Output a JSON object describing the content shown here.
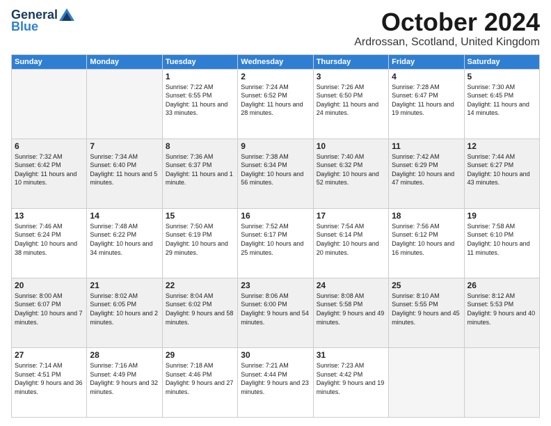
{
  "logo": {
    "general": "General",
    "blue": "Blue"
  },
  "title": "October 2024",
  "location": "Ardrossan, Scotland, United Kingdom",
  "days_of_week": [
    "Sunday",
    "Monday",
    "Tuesday",
    "Wednesday",
    "Thursday",
    "Friday",
    "Saturday"
  ],
  "weeks": [
    [
      {
        "day": "",
        "sunrise": "",
        "sunset": "",
        "daylight": "",
        "empty": true
      },
      {
        "day": "",
        "sunrise": "",
        "sunset": "",
        "daylight": "",
        "empty": true
      },
      {
        "day": "1",
        "sunrise": "Sunrise: 7:22 AM",
        "sunset": "Sunset: 6:55 PM",
        "daylight": "Daylight: 11 hours and 33 minutes."
      },
      {
        "day": "2",
        "sunrise": "Sunrise: 7:24 AM",
        "sunset": "Sunset: 6:52 PM",
        "daylight": "Daylight: 11 hours and 28 minutes."
      },
      {
        "day": "3",
        "sunrise": "Sunrise: 7:26 AM",
        "sunset": "Sunset: 6:50 PM",
        "daylight": "Daylight: 11 hours and 24 minutes."
      },
      {
        "day": "4",
        "sunrise": "Sunrise: 7:28 AM",
        "sunset": "Sunset: 6:47 PM",
        "daylight": "Daylight: 11 hours and 19 minutes."
      },
      {
        "day": "5",
        "sunrise": "Sunrise: 7:30 AM",
        "sunset": "Sunset: 6:45 PM",
        "daylight": "Daylight: 11 hours and 14 minutes."
      }
    ],
    [
      {
        "day": "6",
        "sunrise": "Sunrise: 7:32 AM",
        "sunset": "Sunset: 6:42 PM",
        "daylight": "Daylight: 11 hours and 10 minutes."
      },
      {
        "day": "7",
        "sunrise": "Sunrise: 7:34 AM",
        "sunset": "Sunset: 6:40 PM",
        "daylight": "Daylight: 11 hours and 5 minutes."
      },
      {
        "day": "8",
        "sunrise": "Sunrise: 7:36 AM",
        "sunset": "Sunset: 6:37 PM",
        "daylight": "Daylight: 11 hours and 1 minute."
      },
      {
        "day": "9",
        "sunrise": "Sunrise: 7:38 AM",
        "sunset": "Sunset: 6:34 PM",
        "daylight": "Daylight: 10 hours and 56 minutes."
      },
      {
        "day": "10",
        "sunrise": "Sunrise: 7:40 AM",
        "sunset": "Sunset: 6:32 PM",
        "daylight": "Daylight: 10 hours and 52 minutes."
      },
      {
        "day": "11",
        "sunrise": "Sunrise: 7:42 AM",
        "sunset": "Sunset: 6:29 PM",
        "daylight": "Daylight: 10 hours and 47 minutes."
      },
      {
        "day": "12",
        "sunrise": "Sunrise: 7:44 AM",
        "sunset": "Sunset: 6:27 PM",
        "daylight": "Daylight: 10 hours and 43 minutes."
      }
    ],
    [
      {
        "day": "13",
        "sunrise": "Sunrise: 7:46 AM",
        "sunset": "Sunset: 6:24 PM",
        "daylight": "Daylight: 10 hours and 38 minutes."
      },
      {
        "day": "14",
        "sunrise": "Sunrise: 7:48 AM",
        "sunset": "Sunset: 6:22 PM",
        "daylight": "Daylight: 10 hours and 34 minutes."
      },
      {
        "day": "15",
        "sunrise": "Sunrise: 7:50 AM",
        "sunset": "Sunset: 6:19 PM",
        "daylight": "Daylight: 10 hours and 29 minutes."
      },
      {
        "day": "16",
        "sunrise": "Sunrise: 7:52 AM",
        "sunset": "Sunset: 6:17 PM",
        "daylight": "Daylight: 10 hours and 25 minutes."
      },
      {
        "day": "17",
        "sunrise": "Sunrise: 7:54 AM",
        "sunset": "Sunset: 6:14 PM",
        "daylight": "Daylight: 10 hours and 20 minutes."
      },
      {
        "day": "18",
        "sunrise": "Sunrise: 7:56 AM",
        "sunset": "Sunset: 6:12 PM",
        "daylight": "Daylight: 10 hours and 16 minutes."
      },
      {
        "day": "19",
        "sunrise": "Sunrise: 7:58 AM",
        "sunset": "Sunset: 6:10 PM",
        "daylight": "Daylight: 10 hours and 11 minutes."
      }
    ],
    [
      {
        "day": "20",
        "sunrise": "Sunrise: 8:00 AM",
        "sunset": "Sunset: 6:07 PM",
        "daylight": "Daylight: 10 hours and 7 minutes."
      },
      {
        "day": "21",
        "sunrise": "Sunrise: 8:02 AM",
        "sunset": "Sunset: 6:05 PM",
        "daylight": "Daylight: 10 hours and 2 minutes."
      },
      {
        "day": "22",
        "sunrise": "Sunrise: 8:04 AM",
        "sunset": "Sunset: 6:02 PM",
        "daylight": "Daylight: 9 hours and 58 minutes."
      },
      {
        "day": "23",
        "sunrise": "Sunrise: 8:06 AM",
        "sunset": "Sunset: 6:00 PM",
        "daylight": "Daylight: 9 hours and 54 minutes."
      },
      {
        "day": "24",
        "sunrise": "Sunrise: 8:08 AM",
        "sunset": "Sunset: 5:58 PM",
        "daylight": "Daylight: 9 hours and 49 minutes."
      },
      {
        "day": "25",
        "sunrise": "Sunrise: 8:10 AM",
        "sunset": "Sunset: 5:55 PM",
        "daylight": "Daylight: 9 hours and 45 minutes."
      },
      {
        "day": "26",
        "sunrise": "Sunrise: 8:12 AM",
        "sunset": "Sunset: 5:53 PM",
        "daylight": "Daylight: 9 hours and 40 minutes."
      }
    ],
    [
      {
        "day": "27",
        "sunrise": "Sunrise: 7:14 AM",
        "sunset": "Sunset: 4:51 PM",
        "daylight": "Daylight: 9 hours and 36 minutes."
      },
      {
        "day": "28",
        "sunrise": "Sunrise: 7:16 AM",
        "sunset": "Sunset: 4:49 PM",
        "daylight": "Daylight: 9 hours and 32 minutes."
      },
      {
        "day": "29",
        "sunrise": "Sunrise: 7:18 AM",
        "sunset": "Sunset: 4:46 PM",
        "daylight": "Daylight: 9 hours and 27 minutes."
      },
      {
        "day": "30",
        "sunrise": "Sunrise: 7:21 AM",
        "sunset": "Sunset: 4:44 PM",
        "daylight": "Daylight: 9 hours and 23 minutes."
      },
      {
        "day": "31",
        "sunrise": "Sunrise: 7:23 AM",
        "sunset": "Sunset: 4:42 PM",
        "daylight": "Daylight: 9 hours and 19 minutes."
      },
      {
        "day": "",
        "sunrise": "",
        "sunset": "",
        "daylight": "",
        "empty": true
      },
      {
        "day": "",
        "sunrise": "",
        "sunset": "",
        "daylight": "",
        "empty": true
      }
    ]
  ]
}
